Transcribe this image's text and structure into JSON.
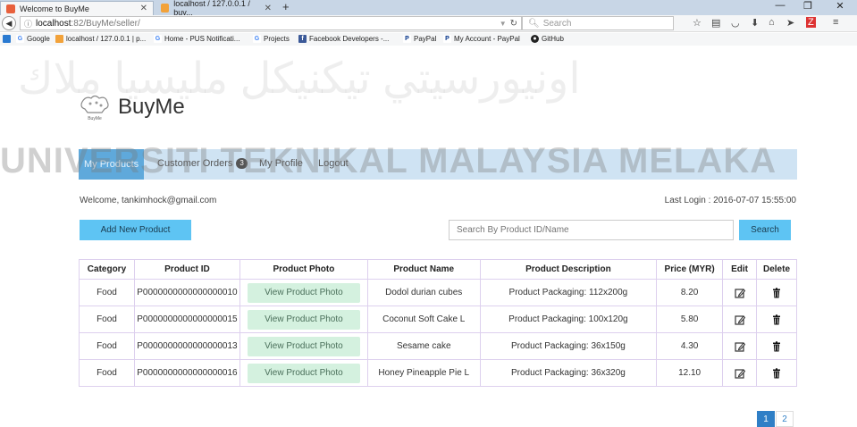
{
  "browser": {
    "tabs": [
      {
        "title": "Welcome to BuyMe",
        "active": true
      },
      {
        "title": "localhost / 127.0.0.1 / buy...",
        "active": false
      }
    ],
    "url_host": "localhost",
    "url_path": ":82/BuyMe/seller/",
    "search_placeholder": "Search",
    "bookmarks": [
      "Google",
      "localhost / 127.0.0.1 | p...",
      "Home - PUS Notificati...",
      "Projects",
      "Facebook Developers -...",
      "PayPal",
      "My Account - PayPal",
      "GitHub"
    ]
  },
  "watermark": {
    "latin": "UNIVERSITI TEKNIKAL MALAYSIA MELAKA",
    "arabic": "اونيورسيتي تيكنيكل مليسيا ملاك"
  },
  "site": {
    "brand": "BuyMe",
    "logo_text": "BuyMe"
  },
  "nav": {
    "items": [
      {
        "label": "My Products",
        "active": true
      },
      {
        "label": "Customer Orders",
        "badge": "3"
      },
      {
        "label": "My Profile"
      },
      {
        "label": "Logout"
      }
    ]
  },
  "user": {
    "welcome": "Welcome, tankimhock@gmail.com",
    "last_login": "Last Login : 2016-07-07 15:55:00"
  },
  "actions": {
    "add_label": "Add New Product",
    "search_placeholder": "Search By Product ID/Name",
    "search_label": "Search"
  },
  "table": {
    "headers": [
      "Category",
      "Product ID",
      "Product Photo",
      "Product Name",
      "Product Description",
      "Price (MYR)",
      "Edit",
      "Delete"
    ],
    "rows": [
      {
        "category": "Food",
        "id": "P0000000000000000010",
        "photo": "View Product Photo",
        "name": "Dodol durian cubes",
        "desc": "Product Packaging: 112x200g",
        "price": "8.20"
      },
      {
        "category": "Food",
        "id": "P0000000000000000015",
        "photo": "View Product Photo",
        "name": "Coconut Soft Cake L",
        "desc": "Product Packaging: 100x120g",
        "price": "5.80"
      },
      {
        "category": "Food",
        "id": "P0000000000000000013",
        "photo": "View Product Photo",
        "name": "Sesame cake",
        "desc": "Product Packaging: 36x150g",
        "price": "4.30"
      },
      {
        "category": "Food",
        "id": "P0000000000000000016",
        "photo": "View Product Photo",
        "name": "Honey Pineapple Pie L",
        "desc": "Product Packaging: 36x320g",
        "price": "12.10"
      }
    ]
  },
  "pagination": {
    "pages": [
      "1",
      "2"
    ],
    "current": "1"
  },
  "colors": {
    "nav_active": "#5fa9db",
    "nav_strip": "#cfe3f3",
    "button": "#5ec4f3",
    "view_button": "#d4f1df",
    "table_border": "#ddd0ee"
  }
}
